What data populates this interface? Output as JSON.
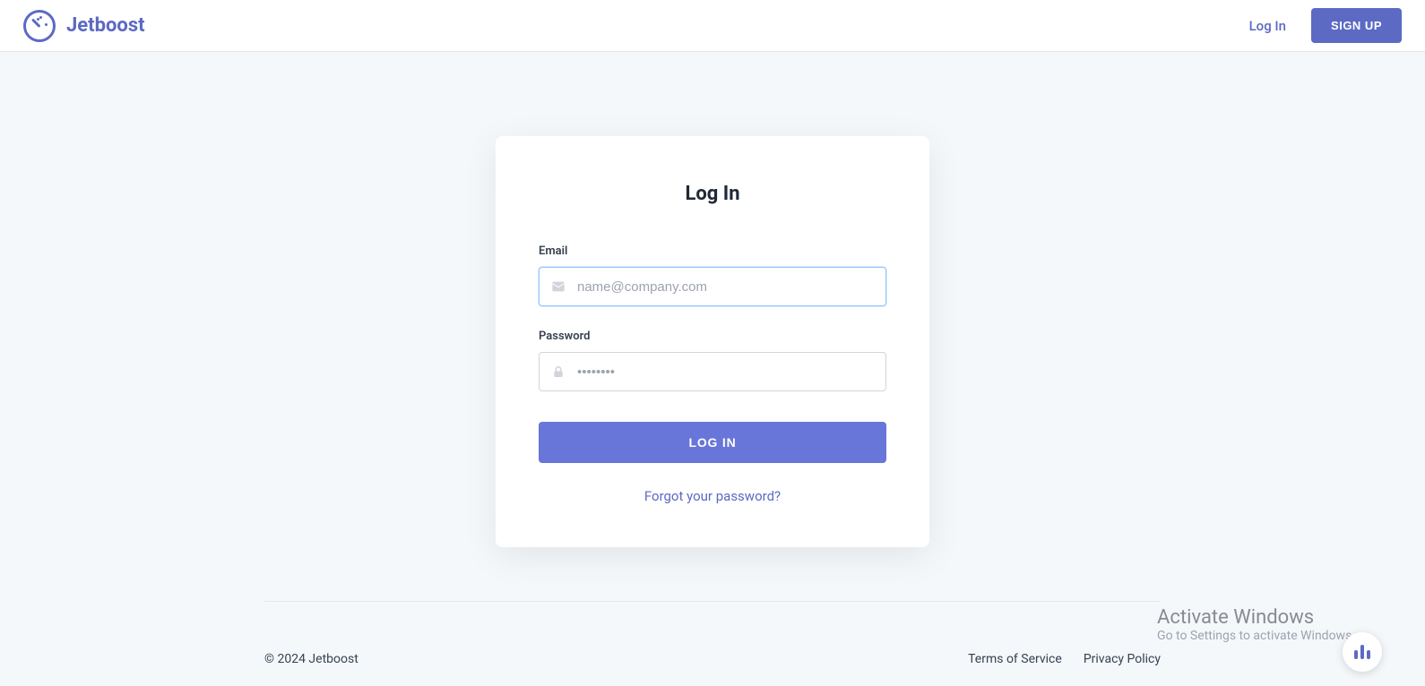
{
  "header": {
    "brand": "Jetboost",
    "login_link": "Log In",
    "signup_button": "SIGN UP"
  },
  "login_card": {
    "title": "Log In",
    "email_label": "Email",
    "email_placeholder": "name@company.com",
    "password_label": "Password",
    "password_placeholder": "••••••••",
    "submit_button": "LOG IN",
    "forgot_link": "Forgot your password?"
  },
  "footer": {
    "copyright": "© 2024 Jetboost",
    "terms": "Terms of Service",
    "privacy": "Privacy Policy"
  },
  "watermark": {
    "title": "Activate Windows",
    "subtitle": "Go to Settings to activate Windows."
  }
}
